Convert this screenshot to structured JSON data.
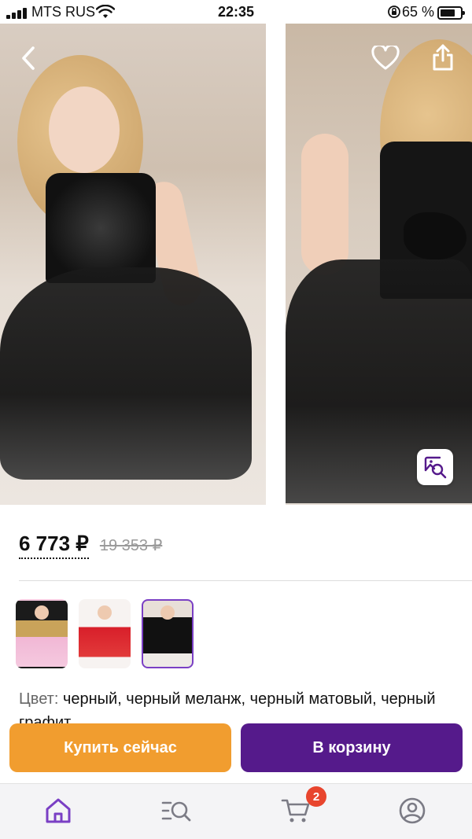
{
  "status_bar": {
    "carrier": "MTS RUS",
    "time": "22:35",
    "battery_percent": "65 %"
  },
  "gallery": {
    "icons": {
      "back": "chevron-left-icon",
      "favorite": "heart-icon",
      "share": "share-icon",
      "image_search": "image-search-icon"
    }
  },
  "product": {
    "price": "6 773 ₽",
    "old_price": "19 353 ₽",
    "color_label": "Цвет:",
    "color_value": "черный, черный меланж, черный матовый, черный графит"
  },
  "actions": {
    "buy_now": "Купить сейчас",
    "add_to_cart": "В корзину"
  },
  "tabbar": {
    "cart_badge": "2",
    "icons": [
      "home-icon",
      "catalog-search-icon",
      "cart-icon",
      "profile-icon"
    ]
  },
  "colors": {
    "accent": "#551a8b",
    "buy_now": "#f19d2f",
    "badge": "#e8452e",
    "active_tab": "#7a3fc4"
  }
}
